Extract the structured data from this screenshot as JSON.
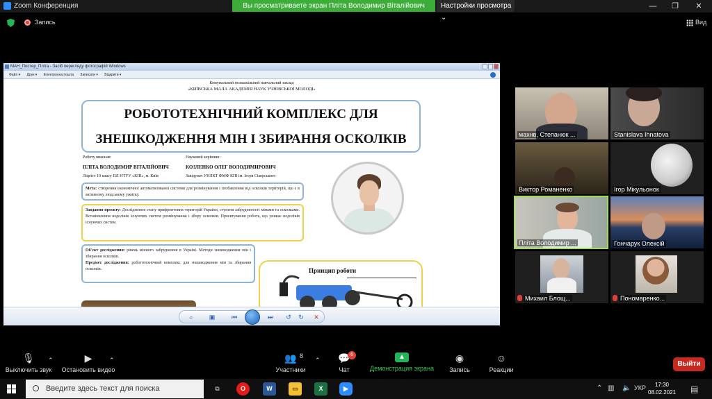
{
  "window": {
    "title": "Zoom Конференция",
    "share_banner": "Вы просматриваете экран Пліта Володимир Віталійович",
    "view_options": "Настройки просмотра ⌄",
    "minimize": "—",
    "restore": "❐",
    "close": "✕"
  },
  "topbar": {
    "record_label": "Запись",
    "gallery_label": "Вид"
  },
  "viewer": {
    "title": "МАН_Постер_Пліта - Засіб перегляду фотографій Windows",
    "menu": [
      "Файл ▾",
      "Друк ▾",
      "Електронна пошта",
      "Записати ▾",
      "Відкрити ▾"
    ]
  },
  "poster": {
    "institution_line1": "Комунальний позашкільний навчальний заклад",
    "institution_line2": "«КИЇВСЬКА МАЛА АКАДЕМІЯ НАУК УЧНІВСЬКОЇ МОЛОДІ»",
    "title_line1": "РОБОТОТЕХНІЧНИЙ КОМПЛЕКС ДЛЯ",
    "title_line2": "ЗНЕШКОДЖЕННЯ МІН І ЗБИРАННЯ ОСКОЛКІВ",
    "author_label": "Роботу виконав:",
    "author_name": "ПЛІТА ВОЛОДИМИР ВІТАЛІЙОВИЧ",
    "author_school": "Ліцеїст 10 класу ПЛ НТУУ «КПІ», м. Київ",
    "advisor_label": "Науковий керівник:",
    "advisor_name": "КОЗЛЕНКО ОЛЕГ ВОЛОДИМИРОВИЧ",
    "advisor_position": "Завідувач УНЛКТ ФМФ КПІ ім. Ігоря Сікорського",
    "goal_label": "Мета:",
    "goal_text": "створення економічної автоматизованої системи для розмінування і позбавлення від осколків територій, що є в активному людському ужитку.",
    "task_label": "Завдання проєкту:",
    "task_text": "Дослідження стану прифронтових територій України, ступеня забрудненості мінами та осколками. Встановлення недоліків існуючих систем розмінування і збору осколків. Проєктування робота, що уникає недоліків існуючих систем.",
    "object_label": "Об'єкт дослідження:",
    "object_text": "рівень мінного забруднення в Україні. Методи знешкодження мін і збирання осколків.",
    "subject_label": "Предмет дослідження:",
    "subject_text": "робототехнічний комплекс для знешкодження мін та збирання осколків.",
    "principle_title": "Принцип роботи"
  },
  "participants": [
    {
      "name": "махнв, Степанюк ...",
      "muted": false,
      "active": false
    },
    {
      "name": "Stanislava Ihnatova",
      "muted": false,
      "active": false
    },
    {
      "name": "Виктор Романенко",
      "muted": false,
      "active": false
    },
    {
      "name": "Ігор Мікульонок",
      "muted": false,
      "active": false
    },
    {
      "name": "Пліта Володимир ...",
      "muted": false,
      "active": true
    },
    {
      "name": "Гончарук Олексій",
      "muted": false,
      "active": false
    },
    {
      "name": "Михаил Блощ...",
      "muted": true,
      "active": false
    },
    {
      "name": "Пономаренко...",
      "muted": true,
      "active": false
    }
  ],
  "toolbar": {
    "mute_label": "Выключить звук",
    "video_label": "Остановить видео",
    "participants_label": "Участники",
    "participants_count": "8",
    "chat_label": "Чат",
    "chat_badge": "6",
    "share_label": "Демонстрация экрана",
    "record_label": "Запись",
    "reactions_label": "Реакции",
    "leave_label": "Выйти"
  },
  "taskbar": {
    "search_placeholder": "Введите здесь текст для поиска",
    "language": "УКР",
    "time": "17:30",
    "date": "08.02.2021"
  },
  "colors": {
    "zoom_blue": "#2d8cff",
    "share_green": "#3dad3a",
    "leave_red": "#c8291f",
    "active_speaker": "#9ee045"
  }
}
